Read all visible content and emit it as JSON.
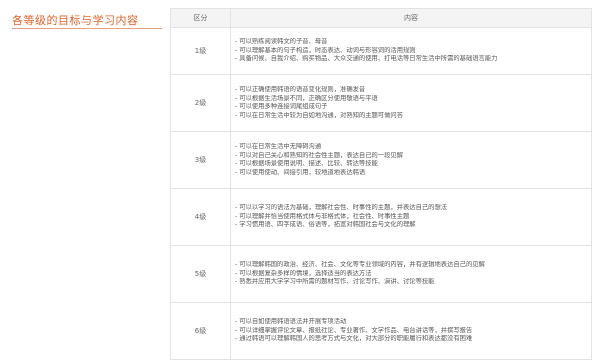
{
  "section": {
    "title": "各等级的目标与学习内容"
  },
  "table": {
    "headers": [
      "区分",
      "内容"
    ],
    "rows": [
      {
        "level": "1级",
        "lines": [
          "- 可以熟练阅读韩文的子音、母音",
          "- 可以理解基本的句子构造，时态表达、动词与形容词的活用规则",
          "- 具备问候、自我介绍、购买物品、大众交通的使用、打电话等日常生活中所需的基础语言能力"
        ]
      },
      {
        "level": "2级",
        "lines": [
          "- 可以正确使用韩语的语音变化规则，准确发音",
          "- 可以根据生活场景不同，正确区分使用敬语与平语",
          "- 可以使用多种连接词尾组成句子",
          "- 可以在日常生活中较为自如地沟通，对熟知的主题可做问答"
        ]
      },
      {
        "level": "3级",
        "lines": [
          "- 可以在日常生活中无障碍沟通",
          "- 可以对自己关心和熟知的社会性主题，表达自己的一段见解",
          "- 可以根据场景使用说明、描述、比较、转达等技能",
          "- 可以使用使动、间接引用，较地道地表达韩语"
        ]
      },
      {
        "level": "4级",
        "lines": [
          "- 可以以学习的语法为基础，理解社会性、时事性的主题，并表达自己的想法",
          "- 可以理解并恰当使用格式体与非格式体，社会性、时事性主题",
          "- 学习惯用语、四字成语、俗语等，拓宽对韩国社会与文化的理解"
        ]
      },
      {
        "level": "5级",
        "lines": [
          "- 可以理解韩国的政治、经济、社会、文化等专业领域的内容，并有逻辑地表达自己的见解",
          "- 可以根据复杂多样的情境，选择适当的表达方法",
          "- 熟悉并应用大学学习中所需的题材写作、讨论写作、演讲、讨论等技能"
        ]
      },
      {
        "level": "6级",
        "lines": [
          "- 可以自如使用韩语语法并开展专项活动",
          "- 可以详细掌握评论文章、报纸社论、专业著作、文学作品、电台讲话等，并撰写报告",
          "- 通过韩语可以理解韩国人的思考方式与文化，对大部分的职能履行和表达都没有困难"
        ]
      }
    ]
  }
}
